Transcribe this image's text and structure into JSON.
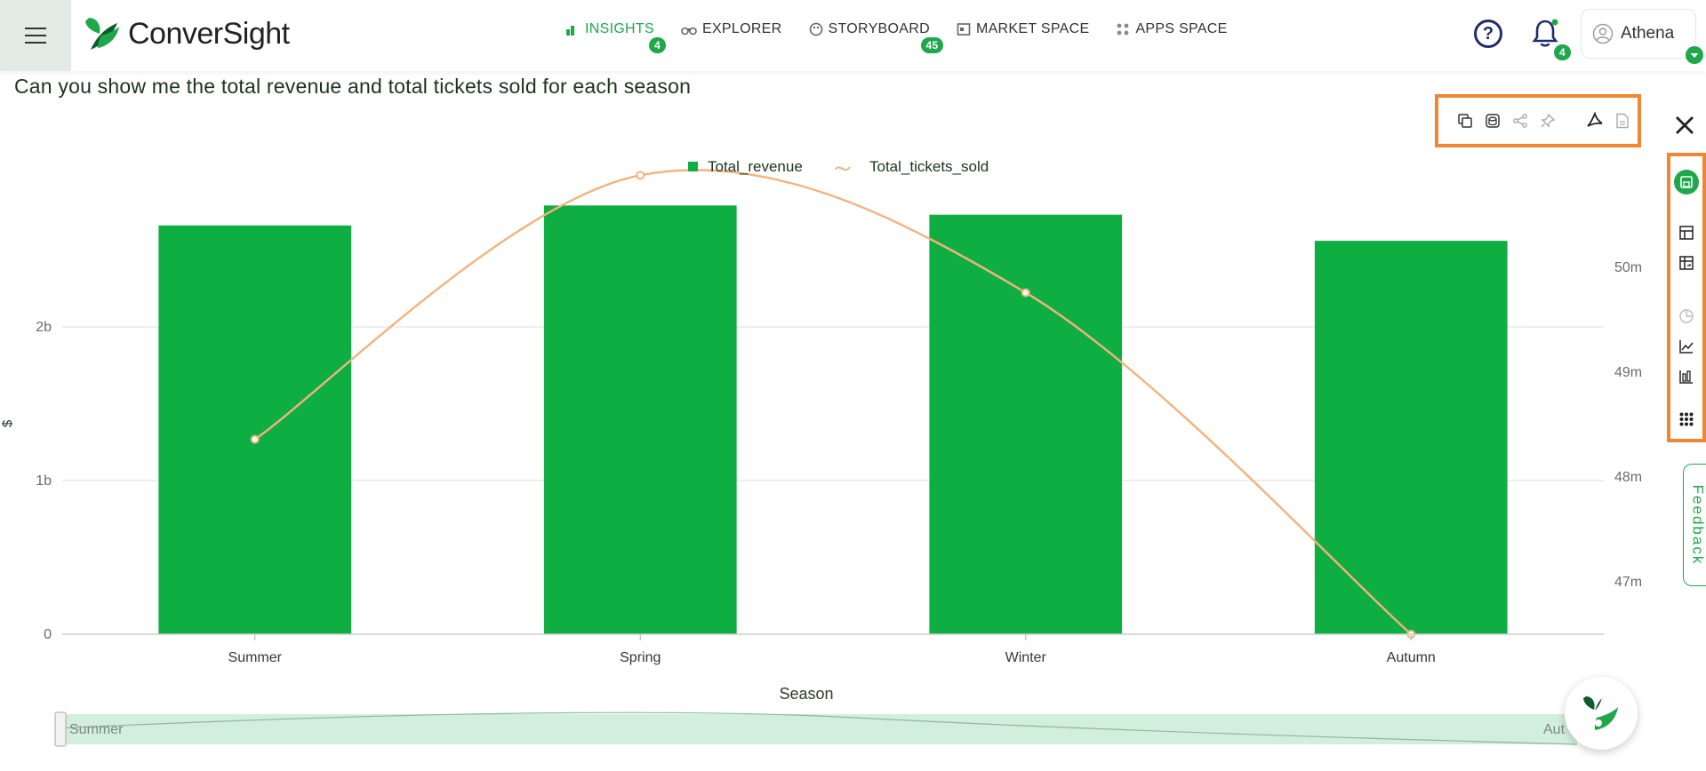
{
  "app": {
    "logo_text": "ConverSight",
    "brand_color": "#1ea84a",
    "accent_color": "#f08632"
  },
  "nav": {
    "items": [
      {
        "label": "INSIGHTS",
        "icon": "bar-chart-icon",
        "badge": "4",
        "active": true
      },
      {
        "label": "EXPLORER",
        "icon": "binoculars-icon",
        "badge": "",
        "active": false
      },
      {
        "label": "STORYBOARD",
        "icon": "palette-icon",
        "badge": "45",
        "active": false
      },
      {
        "label": "MARKET SPACE",
        "icon": "store-icon",
        "badge": "",
        "active": false
      },
      {
        "label": "APPS SPACE",
        "icon": "grid-dots-icon",
        "badge": "",
        "active": false
      }
    ]
  },
  "header": {
    "notification_count": "4",
    "user_name": "Athena"
  },
  "question": "Can you show me the total revenue and total tickets sold for each season",
  "feedback_label": "Feedback",
  "toolbar": {
    "tools": [
      "copy-icon",
      "database-icon",
      "share-icon",
      "pin-icon",
      "pdf-icon",
      "document-icon"
    ]
  },
  "sidebar_tools": [
    "save-icon",
    "table-icon",
    "pivot-table-icon",
    "pie-chart-icon",
    "line-chart-icon",
    "bar-chart-icon",
    "more-grid-icon"
  ],
  "chart_data": {
    "type": "bar",
    "categories": [
      "Summer",
      "Spring",
      "Winter",
      "Autumn"
    ],
    "series": [
      {
        "name": "Total_revenue",
        "type": "bar",
        "axis": "left",
        "color": "#0fae42",
        "values": [
          2660000000.0,
          2790000000.0,
          2730000000.0,
          2560000000.0
        ]
      },
      {
        "name": "Total_tickets_sold",
        "type": "line",
        "axis": "right",
        "color": "#f5b27c",
        "values": [
          48360000,
          50880000,
          49760000,
          46500000
        ]
      }
    ],
    "xlabel": "Season",
    "ylabel": "$",
    "y_left": {
      "min": 0,
      "max": 3000000000,
      "ticks": [
        0,
        1000000000,
        2000000000
      ],
      "tick_labels": [
        "0",
        "1b",
        "2b"
      ]
    },
    "y_right": {
      "min": 46500000,
      "max": 50900000,
      "ticks": [
        47000000,
        48000000,
        49000000,
        50000000
      ],
      "tick_labels": [
        "47m",
        "48m",
        "49m",
        "50m"
      ]
    },
    "legend_position": "top",
    "grid": true,
    "zoom_slider": {
      "start_label": "Summer",
      "end_label": "Aut"
    }
  }
}
